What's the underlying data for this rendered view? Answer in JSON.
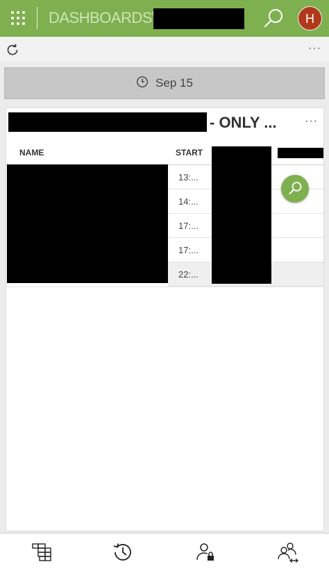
{
  "header": {
    "app_title": "DASHBOARDS\\",
    "avatar_initial": "H",
    "brand_color": "#7fb04f",
    "avatar_color": "#b0391b"
  },
  "toolbar": {
    "more_label": "···"
  },
  "date_filter": {
    "label": "Sep 15",
    "icon": "clock-icon"
  },
  "card": {
    "title_suffix": "- ONLY ...",
    "more_label": "···",
    "columns": [
      "NAME",
      "START"
    ],
    "rows": [
      {
        "start": "13:..."
      },
      {
        "start": "14:..."
      },
      {
        "start": "17:..."
      },
      {
        "start": "17:..."
      },
      {
        "start": "22:..."
      }
    ]
  },
  "bottom_nav": {
    "items": [
      "dashboard-icon",
      "history-icon",
      "user-lock-icon",
      "user-switch-icon"
    ]
  }
}
